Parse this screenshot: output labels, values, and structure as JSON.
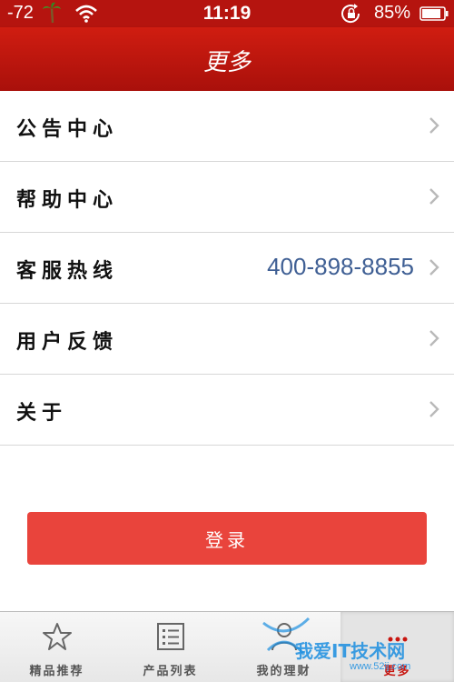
{
  "status_bar": {
    "signal": "-72",
    "time": "11:19",
    "battery_pct": "85%"
  },
  "nav": {
    "title": "更多"
  },
  "menu": {
    "items": [
      {
        "label": "公告中心"
      },
      {
        "label": "帮助中心"
      },
      {
        "label": "客服热线",
        "value": "400-898-8855"
      },
      {
        "label": "用户反馈"
      },
      {
        "label": "关于"
      }
    ]
  },
  "login_label": "登录",
  "tabs": [
    {
      "label": "精品推荐",
      "icon": "star-icon"
    },
    {
      "label": "产品列表",
      "icon": "list-icon"
    },
    {
      "label": "我的理财",
      "icon": "user-icon"
    },
    {
      "label": "更多",
      "icon": "more-icon",
      "active": true
    }
  ],
  "watermark": {
    "text": "我爱IT技术网",
    "sub": "www.52ij.com"
  },
  "colors": {
    "header": "#b5140f",
    "accent_button": "#e9443c",
    "phone_value": "#3f5f94"
  }
}
